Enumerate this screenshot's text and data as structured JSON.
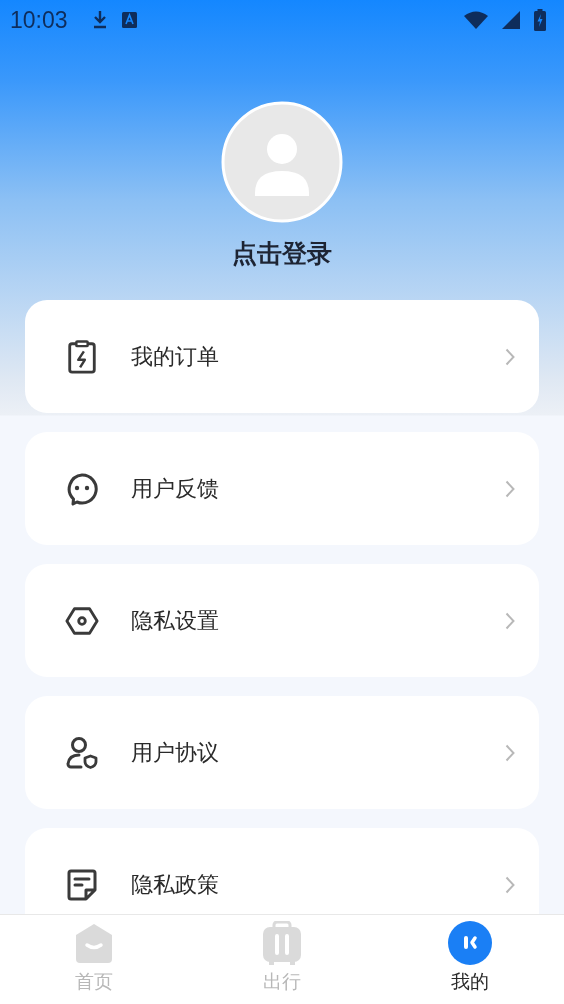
{
  "status_bar": {
    "time": "10:03"
  },
  "profile": {
    "login_label": "点击登录"
  },
  "menu": [
    {
      "label": "我的订单"
    },
    {
      "label": "用户反馈"
    },
    {
      "label": "隐私设置"
    },
    {
      "label": "用户协议"
    },
    {
      "label": "隐私政策"
    }
  ],
  "tab_bar": [
    {
      "label": "首页",
      "selected": false
    },
    {
      "label": "出行",
      "selected": false
    },
    {
      "label": "我的",
      "selected": true
    }
  ]
}
